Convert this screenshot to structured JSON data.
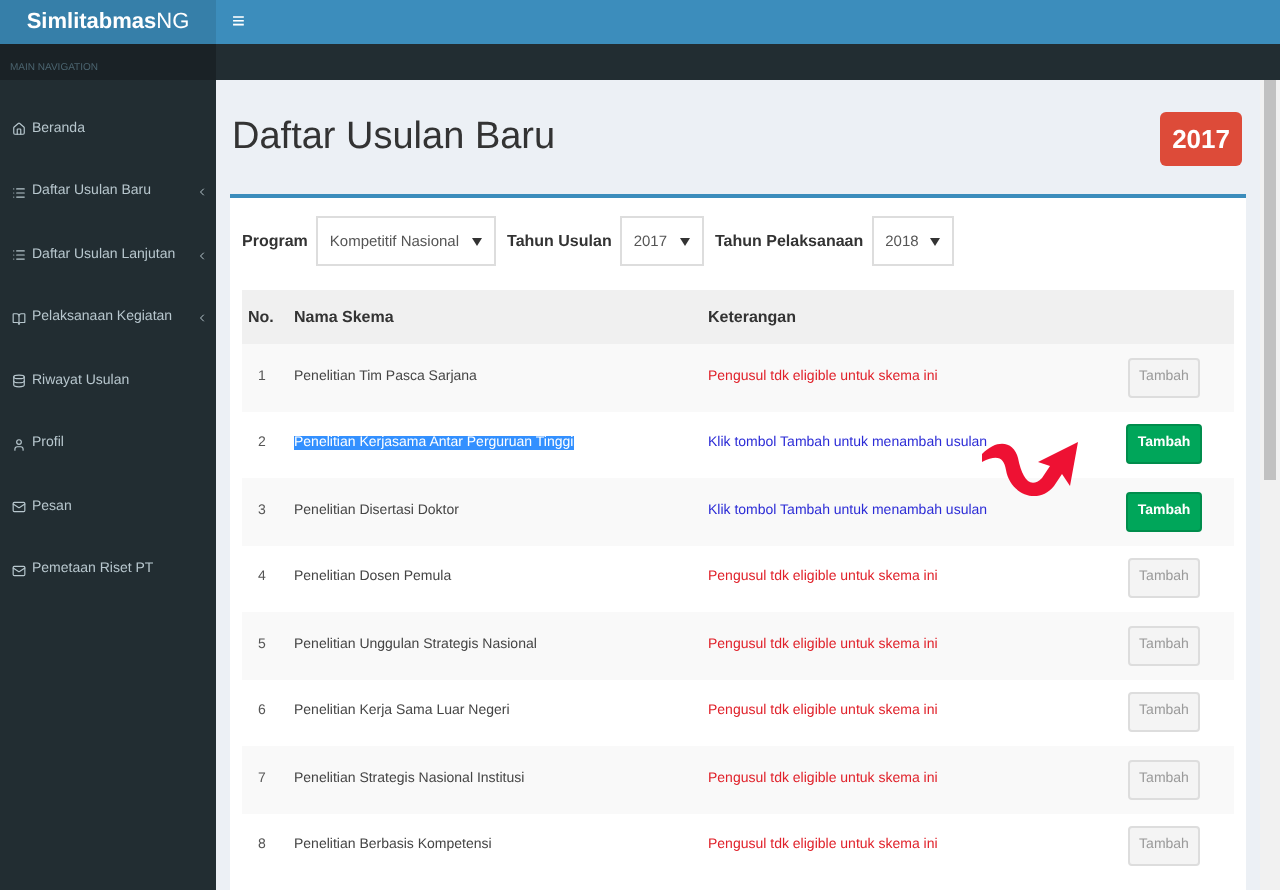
{
  "header": {
    "logo": "**Simlitabmas**NG",
    "menu_toggle": "≡"
  },
  "sidebar": {
    "heading": "MAIN NAVIGATION",
    "items": [
      {
        "label": "Beranda",
        "expandable": false
      },
      {
        "label": "Daftar Usulan Baru",
        "expandable": true
      },
      {
        "label": "Daftar Usulan Lanjutan",
        "expandable": true
      },
      {
        "label": "Pelaksanaan Kegiatan",
        "expandable": true
      },
      {
        "label": "Riwayat Usulan",
        "expandable": false
      },
      {
        "label": "Profil",
        "expandable": false
      },
      {
        "label": "Pesan",
        "expandable": false
      },
      {
        "label": "Pemetaan Riset PT",
        "expandable": false
      }
    ]
  },
  "page": {
    "title": "Daftar Usulan Baru",
    "year_badge": "2017"
  },
  "filters": [
    {
      "label": "Program",
      "value": "Kompetitif Nasional"
    },
    {
      "label": "Tahun Usulan",
      "value": "2017"
    },
    {
      "label": "Tahun Pelaksanaan",
      "value": "2018"
    }
  ],
  "table": {
    "columns": [
      "No.",
      "Nama Skema",
      "Keterangan"
    ],
    "rows": [
      {
        "no": "1",
        "name": "Penelitian Tim Pasca Sarjana",
        "note": "Pengusul tdk eligible untuk skema ini",
        "eligible": false,
        "button": "Tambah",
        "disabled": true,
        "highlighted": false
      },
      {
        "no": "2",
        "name": "Penelitian Kerjasama Antar Perguruan Tinggi",
        "note": "Klik tombol Tambah untuk menambah usulan",
        "eligible": true,
        "button": "Tambah",
        "disabled": false,
        "highlighted": true
      },
      {
        "no": "3",
        "name": "Penelitian Disertasi Doktor",
        "note": "Klik tombol Tambah untuk menambah usulan",
        "eligible": true,
        "button": "Tambah",
        "disabled": false,
        "highlighted": false
      },
      {
        "no": "4",
        "name": "Penelitian Dosen Pemula",
        "note": "Pengusul tdk eligible untuk skema ini",
        "eligible": false,
        "button": "Tambah",
        "disabled": true,
        "highlighted": false
      },
      {
        "no": "5",
        "name": "Penelitian Unggulan Strategis Nasional",
        "note": "Pengusul tdk eligible untuk skema ini",
        "eligible": false,
        "button": "Tambah",
        "disabled": true,
        "highlighted": false
      },
      {
        "no": "6",
        "name": "Penelitian Kerja Sama Luar Negeri",
        "note": "Pengusul tdk eligible untuk skema ini",
        "eligible": false,
        "button": "Tambah",
        "disabled": true,
        "highlighted": false
      },
      {
        "no": "7",
        "name": "Penelitian Strategis Nasional Institusi",
        "note": "Pengusul tdk eligible untuk skema ini",
        "eligible": false,
        "button": "Tambah",
        "disabled": true,
        "highlighted": false
      },
      {
        "no": "8",
        "name": "Penelitian Berbasis Kompetensi",
        "note": "Pengusul tdk eligible untuk skema ini",
        "eligible": false,
        "button": "Tambah",
        "disabled": true,
        "highlighted": false
      }
    ]
  }
}
